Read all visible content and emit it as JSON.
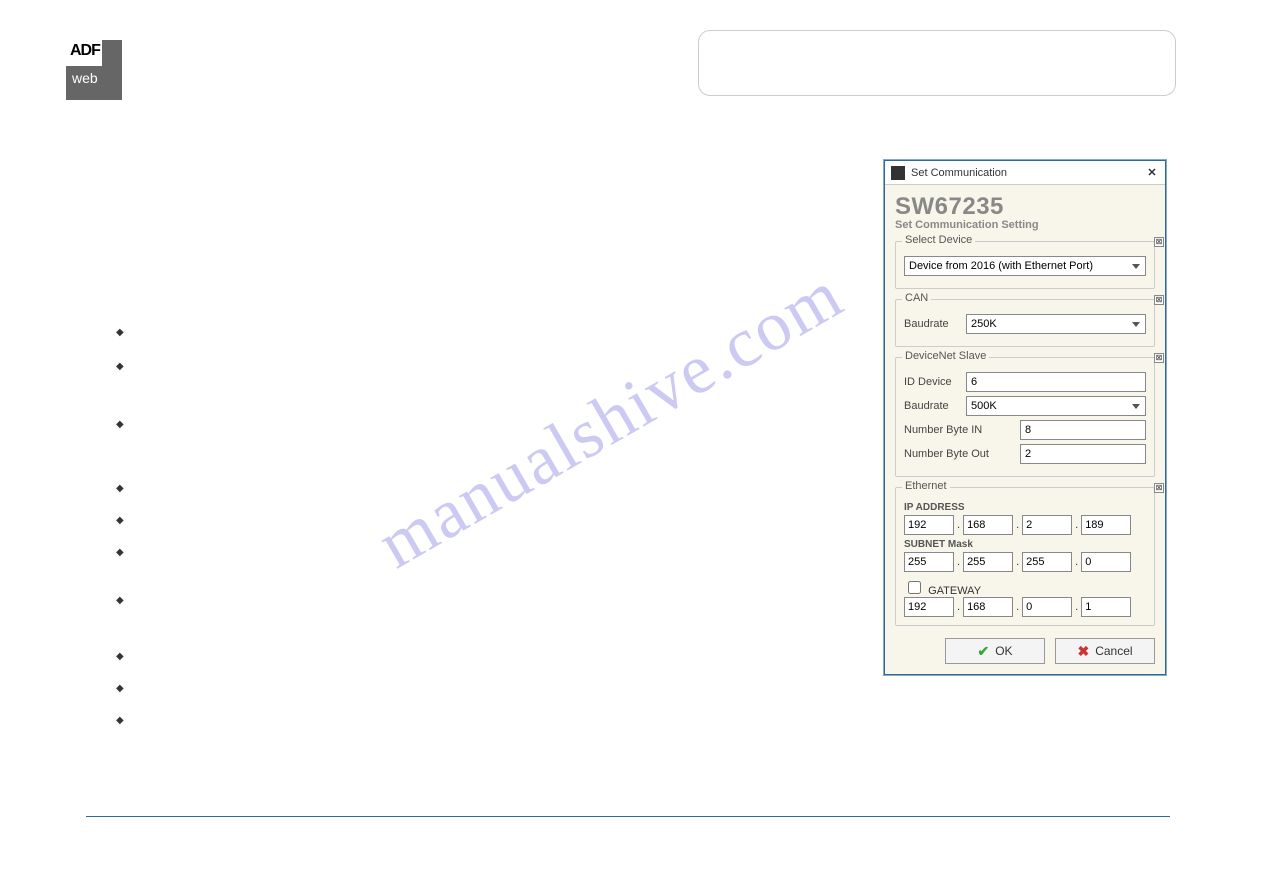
{
  "logo": {
    "line1": "ADF",
    "line2": "web"
  },
  "watermark": "manualshive.com",
  "dialog": {
    "title": "Set Communication",
    "app_code": "SW67235",
    "subtitle": "Set Communication Setting",
    "select_device": {
      "legend": "Select Device",
      "value": "Device from 2016 (with Ethernet Port)"
    },
    "can": {
      "legend": "CAN",
      "baudrate_label": "Baudrate",
      "baudrate_value": "250K"
    },
    "devnet": {
      "legend": "DeviceNet Slave",
      "id_label": "ID Device",
      "id_value": "6",
      "baudrate_label": "Baudrate",
      "baudrate_value": "500K",
      "nbin_label": "Number Byte IN",
      "nbin_value": "8",
      "nbout_label": "Number Byte Out",
      "nbout_value": "2"
    },
    "eth": {
      "legend": "Ethernet",
      "ip_label": "IP ADDRESS",
      "ip": [
        "192",
        "168",
        "2",
        "189"
      ],
      "mask_label": "SUBNET Mask",
      "mask": [
        "255",
        "255",
        "255",
        "0"
      ],
      "gw_label": "GATEWAY",
      "gw_checked": false,
      "gw": [
        "192",
        "168",
        "0",
        "1"
      ]
    },
    "ok_label": "OK",
    "cancel_label": "Cancel",
    "close_glyph": "✕",
    "corner_glyph": "⊠"
  }
}
